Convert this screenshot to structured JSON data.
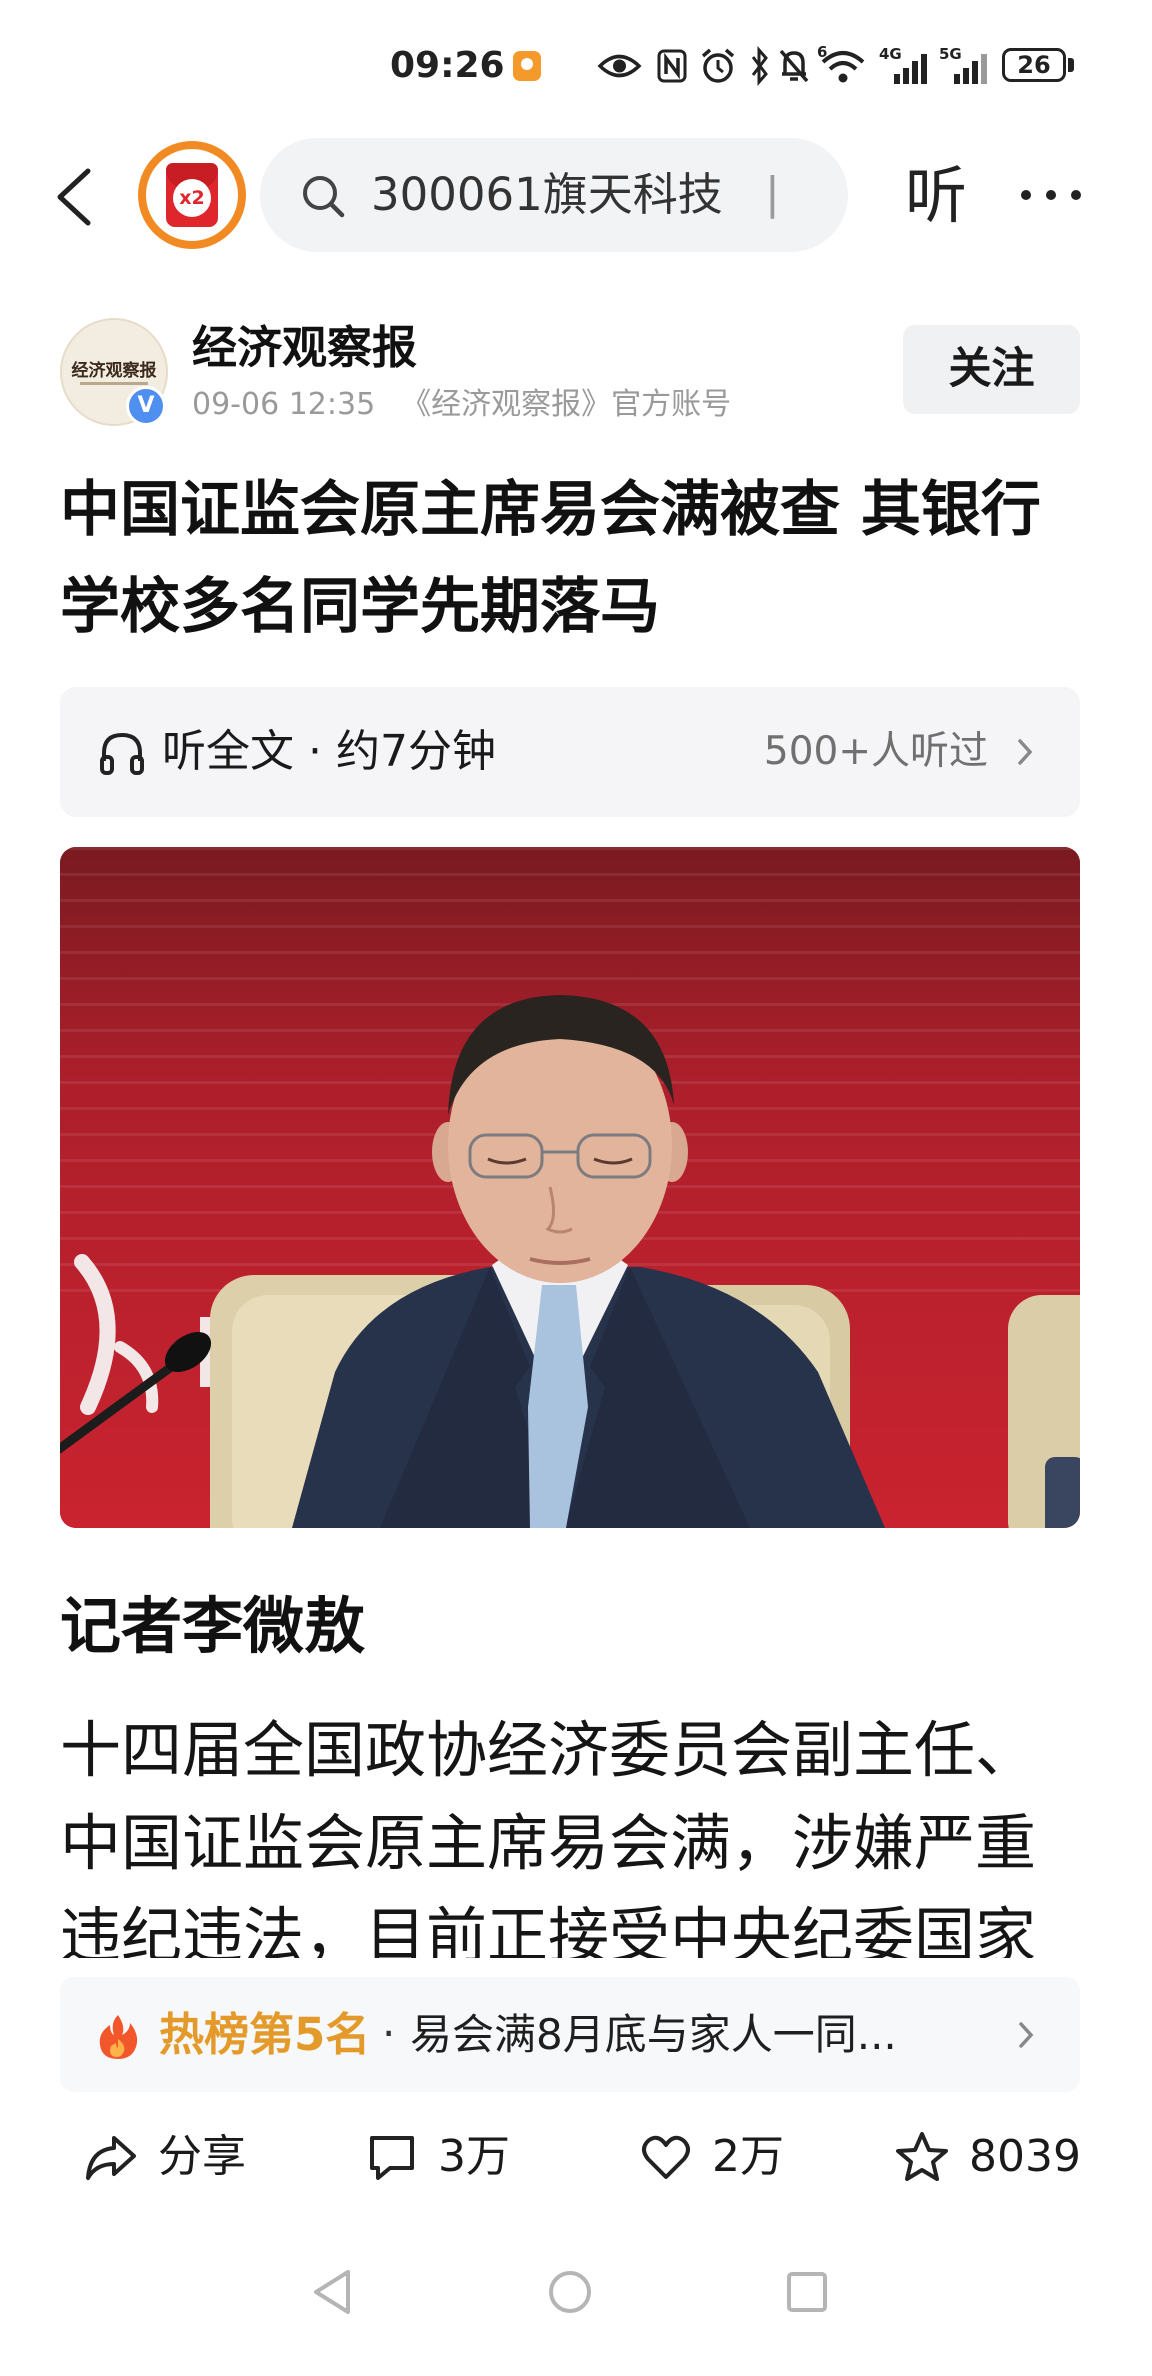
{
  "status_bar": {
    "time": "09:26",
    "wifi_label": "6",
    "signal_1_label": "4G",
    "signal_2_label": "5G",
    "battery": "26",
    "icons": [
      "app-notification-icon",
      "eye-icon",
      "nfc-icon",
      "alarm-icon",
      "bluetooth-icon",
      "mute-bell-icon",
      "wifi-icon",
      "signal-4g-icon",
      "signal-5g-icon",
      "battery-icon"
    ]
  },
  "nav": {
    "back_icon": "back-chevron-icon",
    "avatar_badge": "x2",
    "search_text": "300061旗天科技",
    "search_cursor": "|",
    "listen_label": "听",
    "more_icon": "more-dots-icon"
  },
  "author": {
    "logo_text": "经济观察报",
    "verified_badge": "V",
    "name": "经济观察报",
    "date": "09-06 12:35",
    "account": "《经济观察报》官方账号",
    "follow_label": "关注"
  },
  "article": {
    "title_lines": [
      "中国证监会原主席易会满被查 其银行",
      "学校多名同学先期落马"
    ],
    "listen_bar": {
      "label": "听全文 · 约7分钟",
      "listeners": "500+人听过"
    },
    "reporter": "记者李微敖",
    "paragraph_lines": [
      "十四届全国政协经济委员会副主任、",
      "中国证监会原主席易会满，涉嫌严重",
      "违纪违法，目前正接受中央纪委国家"
    ]
  },
  "hot_bar": {
    "rank": "热榜第5名",
    "separator": "·",
    "headline": "易会满8月底与家人一同..."
  },
  "actions": {
    "share": "分享",
    "comments": "3万",
    "likes": "2万",
    "favorites": "8039"
  },
  "colors": {
    "hot_rank_orange": "#e49a2a",
    "avatar_ring": "#f28a24",
    "verified_blue": "#4f8ff0",
    "photo_backdrop_red": "#b01f2b"
  }
}
